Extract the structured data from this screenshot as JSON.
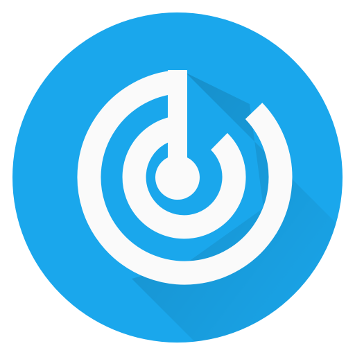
{
  "icon": {
    "name": "radar-target-icon",
    "colors": {
      "background": "#ffffff",
      "circle": "#1aa7ec",
      "circle_shadow": "#0e8ed4",
      "glyph": "#fafafa"
    }
  }
}
